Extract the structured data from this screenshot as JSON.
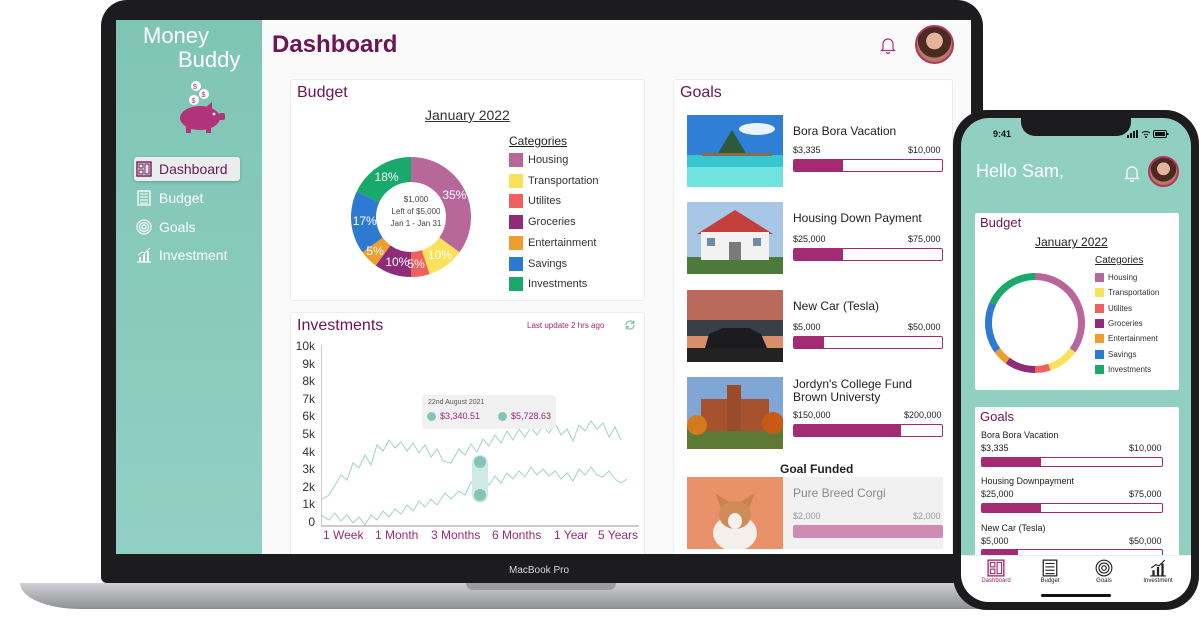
{
  "app": {
    "name_line1": "Money",
    "name_line2": "Buddy",
    "page_title": "Dashboard",
    "device_label": "MacBook Pro"
  },
  "sidebar": {
    "items": [
      {
        "label": "Dashboard",
        "icon": "dashboard-icon",
        "active": true
      },
      {
        "label": "Budget",
        "icon": "budget-icon",
        "active": false
      },
      {
        "label": "Goals",
        "icon": "goals-icon",
        "active": false
      },
      {
        "label": "Investment",
        "icon": "investment-icon",
        "active": false
      }
    ]
  },
  "budget": {
    "title": "Budget",
    "month": "January 2022",
    "center_line1": "$1,000",
    "center_line2": "Left of $5,000",
    "center_line3": "Jan 1 - Jan 31",
    "legend_title": "Categories",
    "categories": [
      {
        "label": "Housing",
        "percent": 35,
        "percent_label": "35%",
        "color": "#b8679a"
      },
      {
        "label": "Transportation",
        "percent": 10,
        "percent_label": "10%",
        "color": "#fbe05a"
      },
      {
        "label": "Utilites",
        "percent": 5,
        "percent_label": "5%",
        "color": "#f0605d"
      },
      {
        "label": "Groceries",
        "percent": 10,
        "percent_label": "10%",
        "color": "#8e2c79"
      },
      {
        "label": "Entertainment",
        "percent": 5,
        "percent_label": "5%",
        "color": "#ef9d2f"
      },
      {
        "label": "Savings",
        "percent": 17,
        "percent_label": "17%",
        "color": "#2f7ad1"
      },
      {
        "label": "Investments",
        "percent": 18,
        "percent_label": "18%",
        "color": "#18a96b"
      }
    ]
  },
  "investments": {
    "title": "Investments",
    "last_update": "Last update 2 hrs ago",
    "y_ticks": [
      "10k",
      "9k",
      "8k",
      "7k",
      "6k",
      "5k",
      "4k",
      "3k",
      "2k",
      "1k",
      "0"
    ],
    "x_ticks": [
      "1 Week",
      "1 Month",
      "3 Months",
      "6 Months",
      "1 Year",
      "5 Years"
    ],
    "tooltip": {
      "date": "22nd August 2021",
      "value1": "$3,340.51",
      "value2": "$5,728.63"
    },
    "colors": {
      "line": "#8fcabe",
      "label": "#9c2a77"
    }
  },
  "goals": {
    "title": "Goals",
    "items": [
      {
        "name": "Bora Bora Vacation",
        "saved": "$3,335",
        "target": "$10,000",
        "progress": 0.33
      },
      {
        "name": "Housing Down Payment",
        "saved": "$25,000",
        "target": "$75,000",
        "progress": 0.33
      },
      {
        "name": "New Car (Tesla)",
        "saved": "$5,000",
        "target": "$50,000",
        "progress": 0.2
      },
      {
        "name": "Jordyn's College Fund\nBrown Universty",
        "saved": "$150,000",
        "target": "$200,000",
        "progress": 0.72
      }
    ],
    "funded_title": "Goal Funded",
    "funded": {
      "name": "Pure Breed Corgi",
      "saved": "$2,000",
      "target": "$2,000",
      "progress": 1.0
    }
  },
  "phone": {
    "time": "9:41",
    "greeting": "Hello Sam,",
    "budget_title": "Budget",
    "month": "January 2022",
    "legend_title": "Categories",
    "goals_title": "Goals",
    "goals": [
      {
        "name": "Bora Bora Vacation",
        "saved": "$3,335",
        "target": "$10,000",
        "progress": 0.33
      },
      {
        "name": "Housing Downpayment",
        "saved": "$25,000",
        "target": "$75,000",
        "progress": 0.33
      },
      {
        "name": "New Car (Tesla)",
        "saved": "$5,000",
        "target": "$50,000",
        "progress": 0.2
      }
    ],
    "tabs": [
      {
        "label": "Dashboard",
        "active": true
      },
      {
        "label": "Budget",
        "active": false
      },
      {
        "label": "Goals",
        "active": false
      },
      {
        "label": "Investment",
        "active": false
      }
    ]
  }
}
